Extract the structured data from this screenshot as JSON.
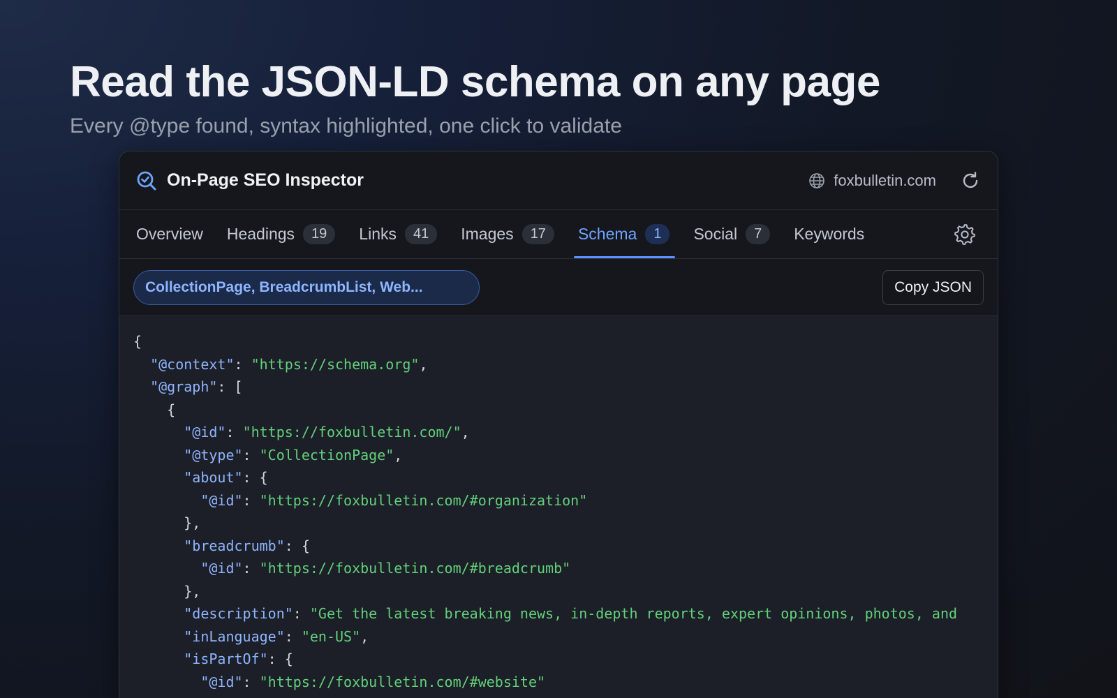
{
  "hero": {
    "title": "Read the JSON-LD schema on any page",
    "subtitle": "Every @type found, syntax highlighted, one click to validate"
  },
  "app": {
    "title": "On-Page SEO Inspector",
    "icon": "magnifier-check-icon",
    "domain": "foxbulletin.com",
    "accent": "#5b93ff"
  },
  "tabs": [
    {
      "label": "Overview",
      "count": null
    },
    {
      "label": "Headings",
      "count": "19"
    },
    {
      "label": "Links",
      "count": "41"
    },
    {
      "label": "Images",
      "count": "17"
    },
    {
      "label": "Schema",
      "count": "1",
      "active": true
    },
    {
      "label": "Social",
      "count": "7"
    },
    {
      "label": "Keywords",
      "count": null
    }
  ],
  "toolbar": {
    "types_label": "CollectionPage, BreadcrumbList, Web...",
    "copy_label": "Copy JSON"
  },
  "code_lines": [
    [
      {
        "t": "p",
        "v": "{"
      }
    ],
    [
      {
        "t": "p",
        "v": "  "
      },
      {
        "t": "k",
        "v": "\"@context\""
      },
      {
        "t": "p",
        "v": ": "
      },
      {
        "t": "s",
        "v": "\"https://schema.org\""
      },
      {
        "t": "p",
        "v": ","
      }
    ],
    [
      {
        "t": "p",
        "v": "  "
      },
      {
        "t": "k",
        "v": "\"@graph\""
      },
      {
        "t": "p",
        "v": ": ["
      }
    ],
    [
      {
        "t": "p",
        "v": "    {"
      }
    ],
    [
      {
        "t": "p",
        "v": "      "
      },
      {
        "t": "k",
        "v": "\"@id\""
      },
      {
        "t": "p",
        "v": ": "
      },
      {
        "t": "s",
        "v": "\"https://foxbulletin.com/\""
      },
      {
        "t": "p",
        "v": ","
      }
    ],
    [
      {
        "t": "p",
        "v": "      "
      },
      {
        "t": "k",
        "v": "\"@type\""
      },
      {
        "t": "p",
        "v": ": "
      },
      {
        "t": "s",
        "v": "\"CollectionPage\""
      },
      {
        "t": "p",
        "v": ","
      }
    ],
    [
      {
        "t": "p",
        "v": "      "
      },
      {
        "t": "k",
        "v": "\"about\""
      },
      {
        "t": "p",
        "v": ": {"
      }
    ],
    [
      {
        "t": "p",
        "v": "        "
      },
      {
        "t": "k",
        "v": "\"@id\""
      },
      {
        "t": "p",
        "v": ": "
      },
      {
        "t": "s",
        "v": "\"https://foxbulletin.com/#organization\""
      }
    ],
    [
      {
        "t": "p",
        "v": "      },"
      }
    ],
    [
      {
        "t": "p",
        "v": "      "
      },
      {
        "t": "k",
        "v": "\"breadcrumb\""
      },
      {
        "t": "p",
        "v": ": {"
      }
    ],
    [
      {
        "t": "p",
        "v": "        "
      },
      {
        "t": "k",
        "v": "\"@id\""
      },
      {
        "t": "p",
        "v": ": "
      },
      {
        "t": "s",
        "v": "\"https://foxbulletin.com/#breadcrumb\""
      }
    ],
    [
      {
        "t": "p",
        "v": "      },"
      }
    ],
    [
      {
        "t": "p",
        "v": "      "
      },
      {
        "t": "k",
        "v": "\"description\""
      },
      {
        "t": "p",
        "v": ": "
      },
      {
        "t": "s",
        "v": "\"Get the latest breaking news, in-depth reports, expert opinions, photos, and"
      }
    ],
    [
      {
        "t": "p",
        "v": "      "
      },
      {
        "t": "k",
        "v": "\"inLanguage\""
      },
      {
        "t": "p",
        "v": ": "
      },
      {
        "t": "s",
        "v": "\"en-US\""
      },
      {
        "t": "p",
        "v": ","
      }
    ],
    [
      {
        "t": "p",
        "v": "      "
      },
      {
        "t": "k",
        "v": "\"isPartOf\""
      },
      {
        "t": "p",
        "v": ": {"
      }
    ],
    [
      {
        "t": "p",
        "v": "        "
      },
      {
        "t": "k",
        "v": "\"@id\""
      },
      {
        "t": "p",
        "v": ": "
      },
      {
        "t": "s",
        "v": "\"https://foxbulletin.com/#website\""
      }
    ]
  ]
}
